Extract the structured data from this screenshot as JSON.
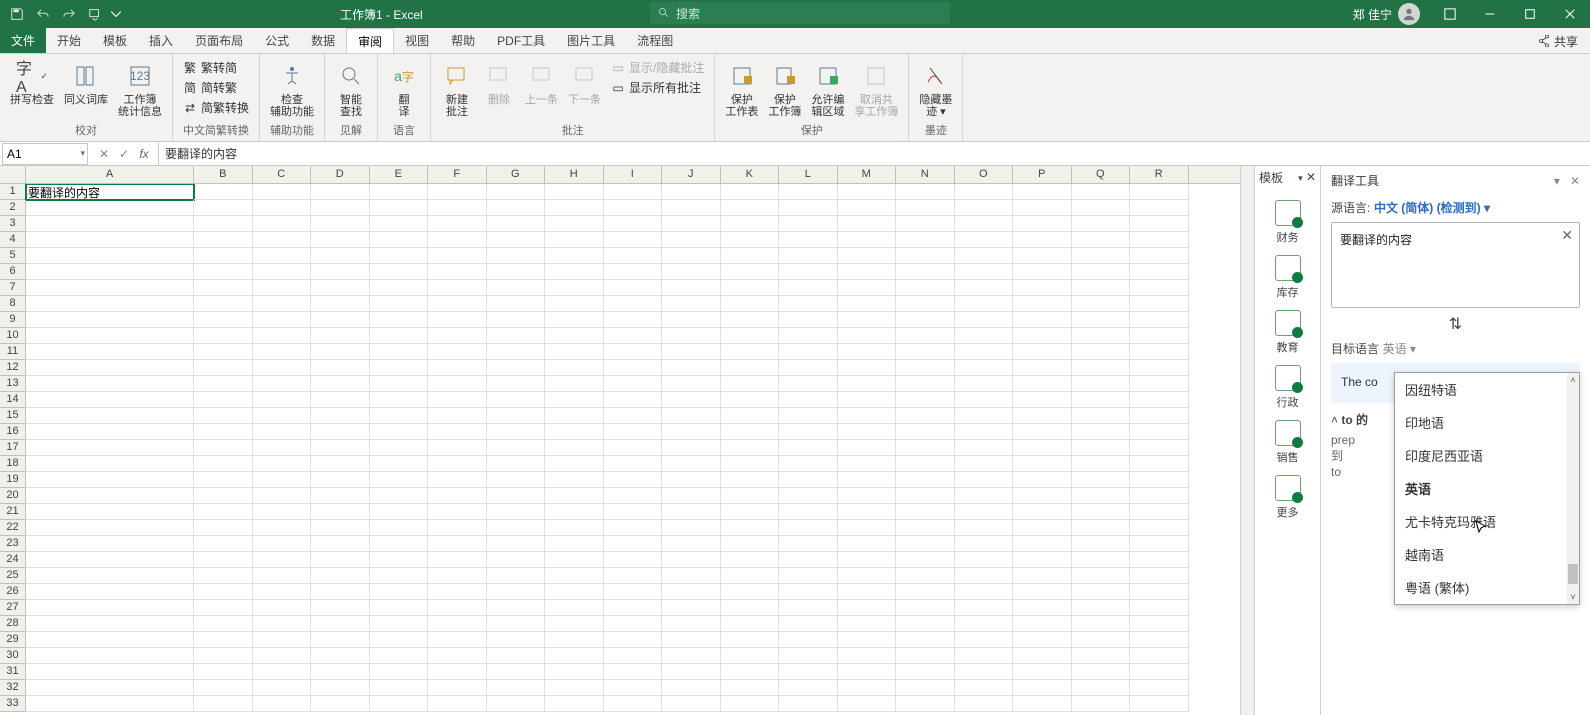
{
  "title": "工作簿1 - Excel",
  "search_placeholder": "搜索",
  "user_name": "郑 佳宁",
  "tabs": {
    "file": "文件",
    "home": "开始",
    "template": "模板",
    "insert": "插入",
    "page": "页面布局",
    "formula": "公式",
    "data": "数据",
    "review": "审阅",
    "view": "视图",
    "help": "帮助",
    "pdf": "PDF工具",
    "image": "图片工具",
    "flow": "流程图"
  },
  "share_label": "共享",
  "ribbon": {
    "proof": {
      "spell": "拼写检查",
      "thes": "同义词库",
      "stats": "工作簿\n统计信息",
      "grp": "校对"
    },
    "cn": {
      "a": "繁转简",
      "b": "简转繁",
      "c": "简繁转换",
      "grp": "中文简繁转换"
    },
    "acc": {
      "check": "检查\n辅助功能",
      "grp": "辅助功能"
    },
    "insight": {
      "smart": "智能\n查找",
      "grp": "见解"
    },
    "lang": {
      "trans": "翻\n译",
      "grp": "语言"
    },
    "comments": {
      "new": "新建\n批注",
      "del": "删除",
      "prev": "上一条",
      "next": "下一条",
      "show": "显示/隐藏批注",
      "showall": "显示所有批注",
      "grp": "批注"
    },
    "protect": {
      "sheet": "保护\n工作表",
      "book": "保护\n工作簿",
      "range": "允许编\n辑区域",
      "unshare": "取消共\n享工作簿",
      "grp": "保护"
    },
    "ink": {
      "hide": "隐藏墨\n迹 ▾",
      "grp": "墨迹"
    }
  },
  "namebox": "A1",
  "formula": "要翻译的内容",
  "columns": [
    "A",
    "B",
    "C",
    "D",
    "E",
    "F",
    "G",
    "H",
    "I",
    "J",
    "K",
    "L",
    "M",
    "N",
    "O",
    "P",
    "Q",
    "R"
  ],
  "rows": 33,
  "cell_A1": "要翻译的内容",
  "tpane": {
    "header": "模板",
    "items": [
      {
        "key": "fin",
        "label": "财务"
      },
      {
        "key": "inv",
        "label": "库存"
      },
      {
        "key": "edu",
        "label": "教育"
      },
      {
        "key": "admin",
        "label": "行政"
      },
      {
        "key": "sales",
        "label": "销售"
      },
      {
        "key": "more",
        "label": "更多"
      }
    ]
  },
  "trans": {
    "title": "翻译工具",
    "src_label": "源语言:",
    "src_lang": "中文 (简体) (检测到)",
    "input": "要翻译的内容",
    "tgt_label": "目标语言",
    "tgt_lang": "英语",
    "output": "The co",
    "def_head": "to 的",
    "def_prep": "prep",
    "def_line1": "到",
    "def_line2": "to",
    "langs": [
      "因纽特语",
      "印地语",
      "印度尼西亚语",
      "英语",
      "尤卡特克玛雅语",
      "越南语",
      "粤语 (繁体)"
    ]
  }
}
